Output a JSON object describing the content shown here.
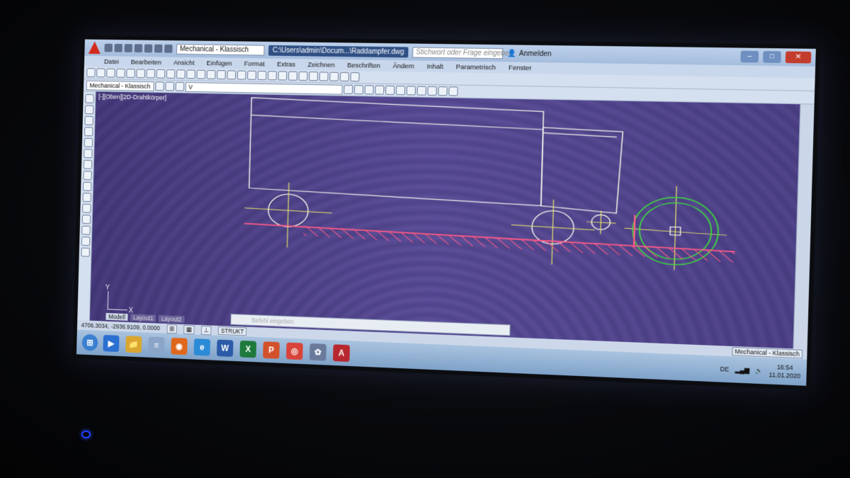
{
  "window": {
    "workspace": "Mechanical - Klassisch",
    "document_title": "C:\\Users\\admin\\Docum...\\Raddampfer.dwg",
    "search_placeholder": "Stichwort oder Frage eingeben",
    "login_label": "Anmelden"
  },
  "menu": [
    "Datei",
    "Bearbeiten",
    "Ansicht",
    "Einfügen",
    "Format",
    "Extras",
    "Zeichnen",
    "Beschriften",
    "Ändern",
    "Inhalt",
    "Parametrisch",
    "Fenster"
  ],
  "toolbar": {
    "workspace_combo": "Mechanical - Klassisch",
    "layer_combo": "V"
  },
  "viewport": {
    "label": "[-][Oben][2D-Drahtkörper]",
    "ucs_x": "X",
    "ucs_y": "Y"
  },
  "tabs": [
    "Modell",
    "Layout1",
    "Layout2"
  ],
  "command_placeholder": "Befehl eingeben",
  "status": {
    "coords": "4706.3034, -2936.9109, 0.0000",
    "strukt": "STRUKT",
    "workspace": "Mechanical - Klassisch"
  },
  "taskbar": {
    "language": "DE",
    "time": "16:54",
    "date": "11.01.2020",
    "apps": [
      {
        "name": "windows-media-player",
        "label": "▶",
        "color": "#2b6fd1"
      },
      {
        "name": "explorer",
        "label": "📁",
        "color": "#d9a630"
      },
      {
        "name": "notepad",
        "label": "≡",
        "color": "#8aa5c8"
      },
      {
        "name": "firefox",
        "label": "◉",
        "color": "#e0661b"
      },
      {
        "name": "internet-explorer",
        "label": "e",
        "color": "#2a8ad6"
      },
      {
        "name": "word",
        "label": "W",
        "color": "#2a5aa8"
      },
      {
        "name": "excel",
        "label": "X",
        "color": "#1e7a3c"
      },
      {
        "name": "powerpoint",
        "label": "P",
        "color": "#d2512b"
      },
      {
        "name": "chrome",
        "label": "◎",
        "color": "#d8443a"
      },
      {
        "name": "misc-app",
        "label": "✿",
        "color": "#6a7a9a"
      },
      {
        "name": "autocad",
        "label": "A",
        "color": "#b7282e"
      }
    ]
  },
  "colors": {
    "drawing_lines": "#f2f2ea",
    "center_lines": "#e8e86a",
    "ground_hatch": "#ff5a86",
    "green_wheel": "#3ddc3d"
  }
}
